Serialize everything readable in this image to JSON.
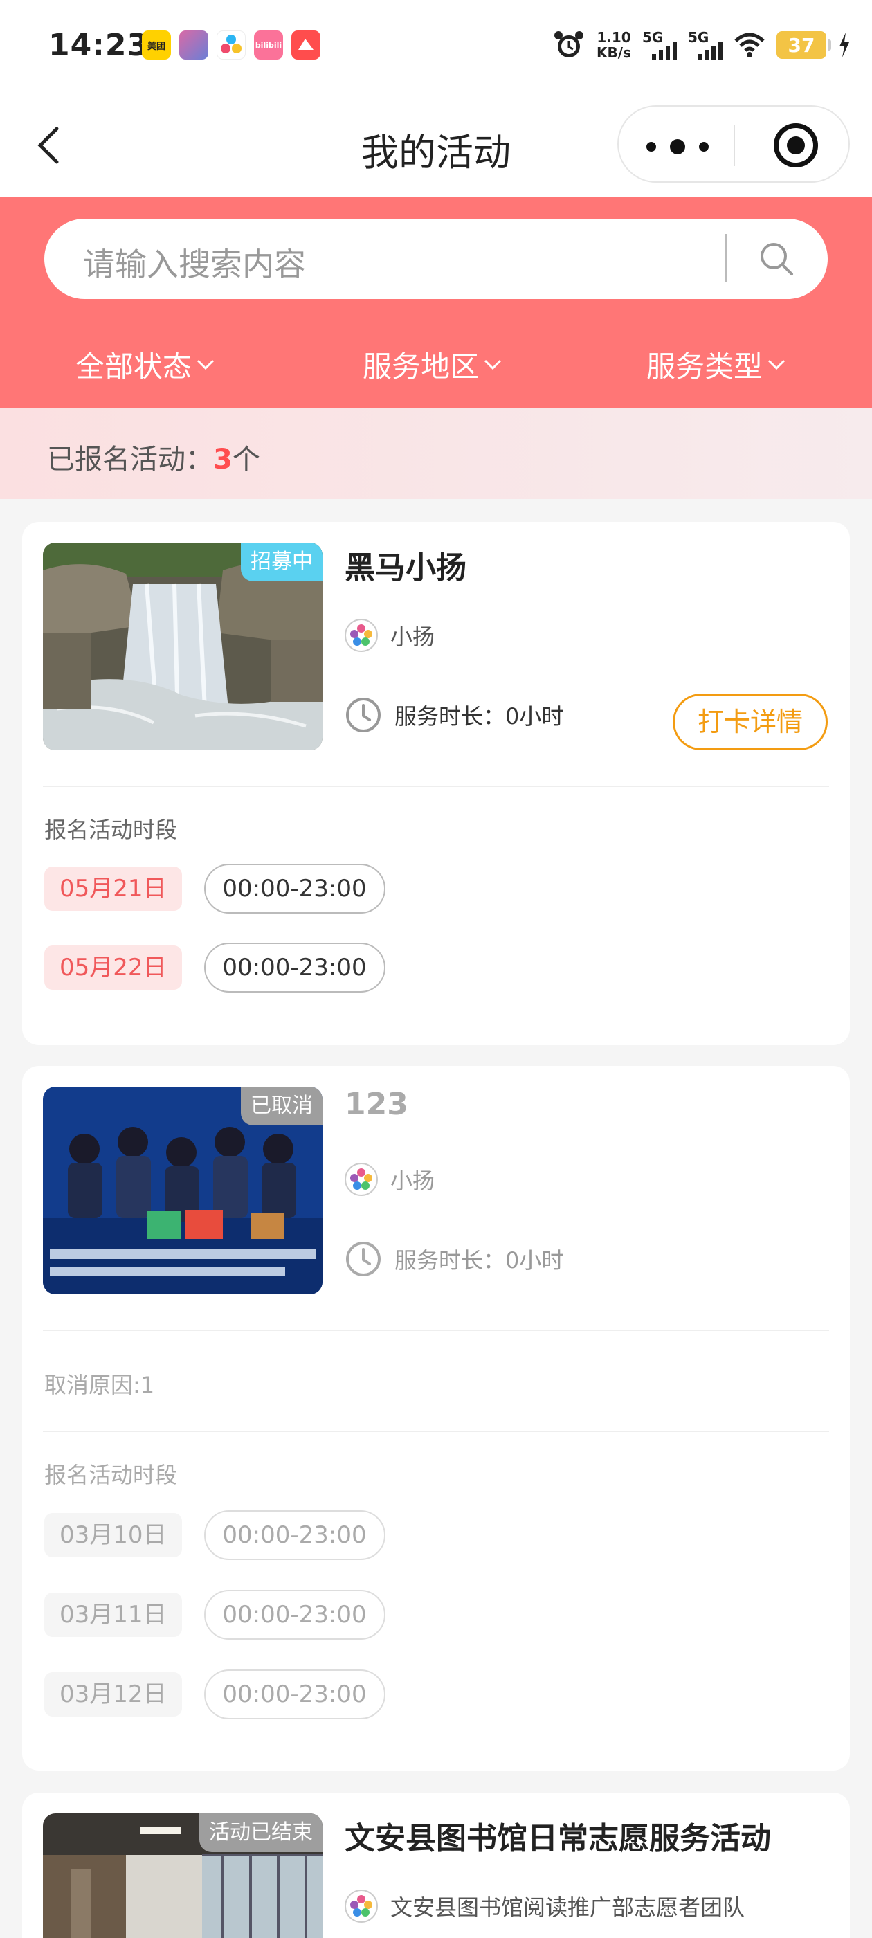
{
  "status_bar": {
    "time": "14:23",
    "apps": [
      {
        "icon": "meituan-app-icon",
        "label": "美团",
        "color": "#ffd100"
      },
      {
        "icon": "game-app-icon",
        "label": "",
        "color": "#6a7fd6"
      },
      {
        "icon": "pinwheel-app-icon",
        "label": "",
        "color": "#ffffff"
      },
      {
        "icon": "bilibili-app-icon",
        "label": "bilibili",
        "color": "#fb7299"
      },
      {
        "icon": "news-app-icon",
        "label": "",
        "color": "#ff4d4d"
      }
    ],
    "net_speed_value": "1.10",
    "net_speed_unit": "KB/s",
    "sim1": "5G",
    "sim2": "5G",
    "battery": "37"
  },
  "nav": {
    "title": "我的活动"
  },
  "search": {
    "placeholder": "请输入搜索内容"
  },
  "filters": [
    {
      "label": "全部状态"
    },
    {
      "label": "服务地区"
    },
    {
      "label": "服务类型"
    }
  ],
  "count": {
    "label": "已报名活动：",
    "value": "3",
    "unit": "个"
  },
  "activities": [
    {
      "title": "黑马小扬",
      "badge": "招募中",
      "badge_color": "#5ad1f0",
      "organizer": "小扬",
      "duration_label": "服务时长：",
      "duration_value": "0小时",
      "checkin_button": "打卡详情",
      "slots_label": "报名活动时段",
      "slots": [
        {
          "date": "05月21日",
          "time": "00:00-23:00"
        },
        {
          "date": "05月22日",
          "time": "00:00-23:00"
        }
      ]
    },
    {
      "title": "123",
      "badge": "已取消",
      "badge_color": "#9e9e9e",
      "organizer": "小扬",
      "duration_label": "服务时长：",
      "duration_value": "0小时",
      "cancel_reason": "取消原因:1",
      "slots_label": "报名活动时段",
      "slots": [
        {
          "date": "03月10日",
          "time": "00:00-23:00"
        },
        {
          "date": "03月11日",
          "time": "00:00-23:00"
        },
        {
          "date": "03月12日",
          "time": "00:00-23:00"
        }
      ]
    },
    {
      "title": "文安县图书馆日常志愿服务活动",
      "badge": "活动已结束",
      "badge_color": "#9e9e9e",
      "organizer": "文安县图书馆阅读推广部志愿者团队"
    }
  ]
}
